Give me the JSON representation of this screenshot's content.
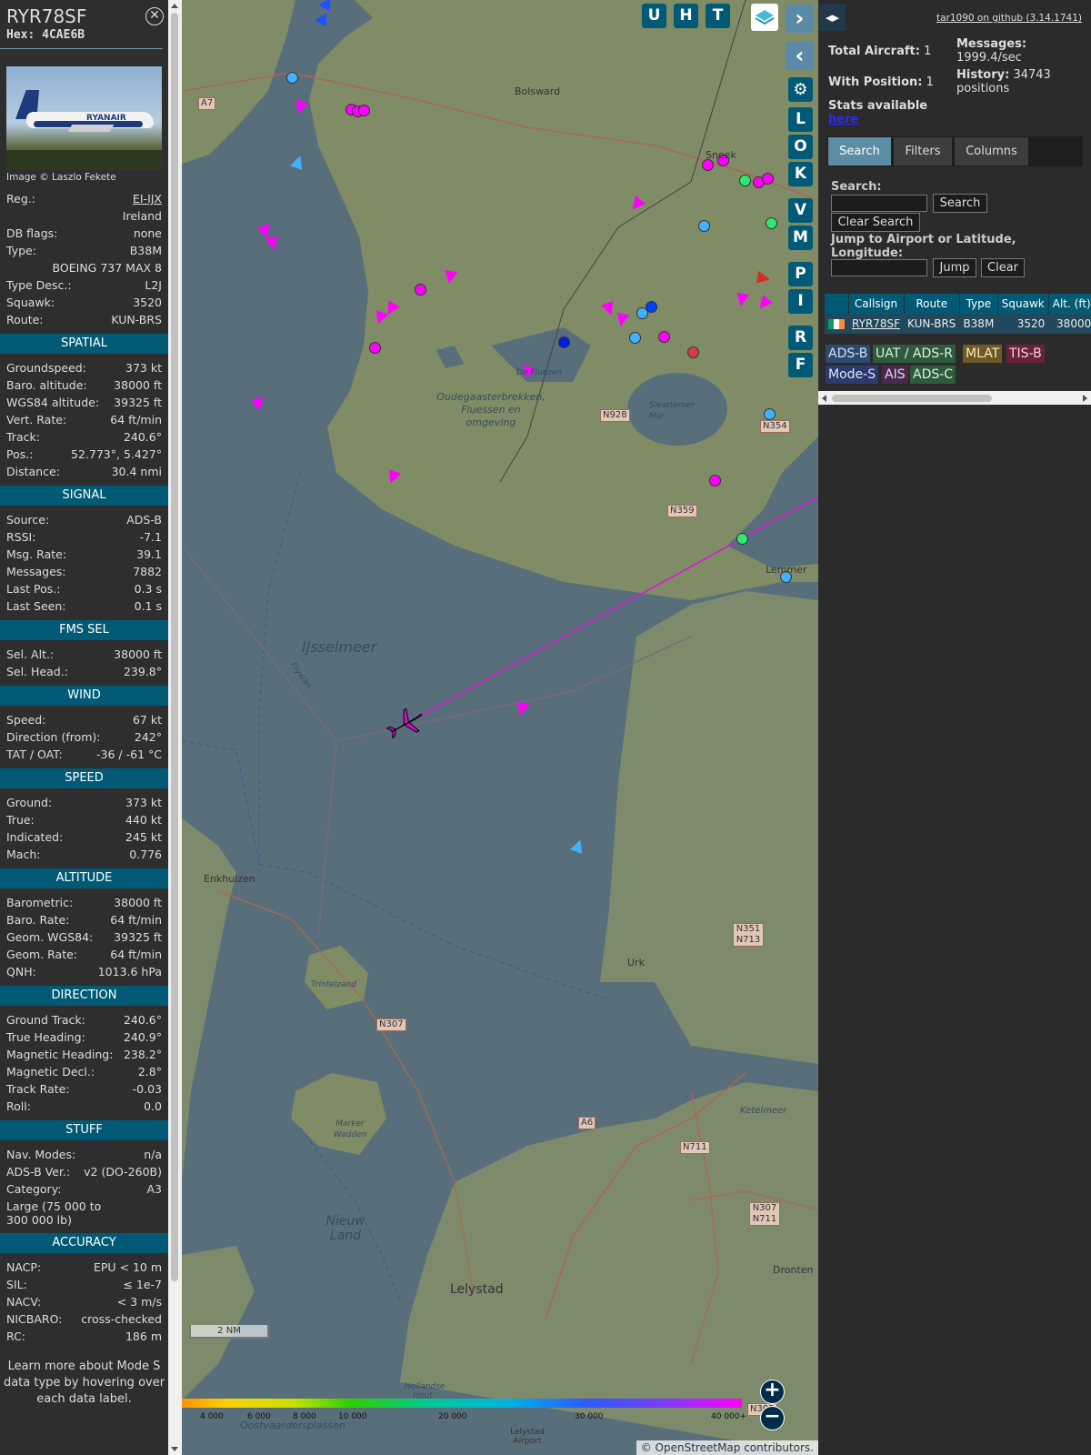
{
  "infoblock": {
    "callsign": "RYR78SF",
    "hex": "Hex: 4CAE6B",
    "photo_brand": "RYANAIR",
    "photo_credit": "Image © Laszlo Fekete",
    "details": [
      {
        "k": "Reg.:",
        "v": "EI-IJX"
      },
      {
        "k": "",
        "v": "Ireland"
      },
      {
        "k": "DB flags:",
        "v": "none"
      },
      {
        "k": "Type:",
        "v": "B38M"
      },
      {
        "k": "",
        "v": "BOEING 737 MAX 8"
      },
      {
        "k": "Type Desc.:",
        "v": "L2J"
      },
      {
        "k": "Squawk:",
        "v": "3520"
      },
      {
        "k": "Route:",
        "v": "KUN-BRS"
      }
    ],
    "sections": [
      {
        "title": "SPATIAL",
        "rows": [
          {
            "k": "Groundspeed:",
            "v": "373 kt"
          },
          {
            "k": "Baro. altitude:",
            "v": "38000 ft"
          },
          {
            "k": "WGS84 altitude:",
            "v": "39325 ft"
          },
          {
            "k": "Vert. Rate:",
            "v": "64 ft/min"
          },
          {
            "k": "Track:",
            "v": "240.6°"
          },
          {
            "k": "Pos.:",
            "v": "52.773°, 5.427°"
          },
          {
            "k": "Distance:",
            "v": "30.4 nmi"
          }
        ]
      },
      {
        "title": "SIGNAL",
        "rows": [
          {
            "k": "Source:",
            "v": "ADS-B"
          },
          {
            "k": "RSSI:",
            "v": "-7.1"
          },
          {
            "k": "Msg. Rate:",
            "v": "39.1"
          },
          {
            "k": "Messages:",
            "v": "7882"
          },
          {
            "k": "Last Pos.:",
            "v": "0.3 s"
          },
          {
            "k": "Last Seen:",
            "v": "0.1 s"
          }
        ]
      },
      {
        "title": "FMS SEL",
        "rows": [
          {
            "k": "Sel. Alt.:",
            "v": "38000 ft"
          },
          {
            "k": "Sel. Head.:",
            "v": "239.8°"
          }
        ]
      },
      {
        "title": "WIND",
        "rows": [
          {
            "k": "Speed:",
            "v": "67 kt"
          },
          {
            "k": "Direction (from):",
            "v": "242°"
          },
          {
            "k": "TAT / OAT:",
            "v": "-36 / -61 °C"
          }
        ]
      },
      {
        "title": "SPEED",
        "rows": [
          {
            "k": "Ground:",
            "v": "373 kt"
          },
          {
            "k": "True:",
            "v": "440 kt"
          },
          {
            "k": "Indicated:",
            "v": "245 kt"
          },
          {
            "k": "Mach:",
            "v": "0.776"
          }
        ]
      },
      {
        "title": "ALTITUDE",
        "rows": [
          {
            "k": "Barometric:",
            "v": "38000 ft"
          },
          {
            "k": "Baro. Rate:",
            "v": "64 ft/min"
          },
          {
            "k": "Geom. WGS84:",
            "v": "39325 ft"
          },
          {
            "k": "Geom. Rate:",
            "v": "64 ft/min"
          },
          {
            "k": "QNH:",
            "v": "1013.6 hPa"
          }
        ]
      },
      {
        "title": "DIRECTION",
        "rows": [
          {
            "k": "Ground Track:",
            "v": "240.6°"
          },
          {
            "k": "True Heading:",
            "v": "240.9°"
          },
          {
            "k": "Magnetic Heading:",
            "v": "238.2°"
          },
          {
            "k": "Magnetic Decl.:",
            "v": "2.8°"
          },
          {
            "k": "Track Rate:",
            "v": "-0.03"
          },
          {
            "k": "Roll:",
            "v": "0.0"
          }
        ]
      },
      {
        "title": "STUFF",
        "rows": [
          {
            "k": "Nav. Modes:",
            "v": "n/a"
          },
          {
            "k": "ADS-B Ver.:",
            "v": "v2 (DO-260B)"
          },
          {
            "k": "Category:",
            "v": "A3"
          },
          {
            "k": "Large (75 000 to 300 000 lb)",
            "v": "",
            "wrap": true
          }
        ]
      },
      {
        "title": "ACCURACY",
        "rows": [
          {
            "k": "NACP:",
            "v": "EPU < 10 m"
          },
          {
            "k": "SIL:",
            "v": "≤ 1e-7"
          },
          {
            "k": "NACV:",
            "v": "< 3 m/s"
          },
          {
            "k": "NICBARO:",
            "v": "cross-checked"
          },
          {
            "k": "RC:",
            "v": "186 m"
          }
        ]
      }
    ],
    "learn_more": "Learn more about Mode S data type by hovering over each data label."
  },
  "map": {
    "buttons_top": [
      "U",
      "H",
      "T"
    ],
    "buttons_side": [
      "L",
      "O",
      "K",
      "V",
      "M",
      "P",
      "I",
      "R",
      "F"
    ],
    "labels": [
      {
        "id": "bolsward",
        "text": "Bolsward"
      },
      {
        "id": "sneek",
        "text": "Sneek"
      },
      {
        "id": "ijsselmeer",
        "text": "IJsselmeer"
      },
      {
        "id": "oudega",
        "text": "Oudegaasterbrekken, Fluessen en omgeving"
      },
      {
        "id": "sleattemer",
        "text": "Sleattemer Mar"
      },
      {
        "id": "lemmer",
        "text": "Lemmer"
      },
      {
        "id": "enkhuizen",
        "text": "Enkhuizen"
      },
      {
        "id": "urk",
        "text": "Urk"
      },
      {
        "id": "lelystad",
        "text": "Lelystad"
      },
      {
        "id": "dronten",
        "text": "Dronten"
      },
      {
        "id": "nieuw-land",
        "text": "Nieuw Land"
      },
      {
        "id": "marker-wadden",
        "text": "Marker Wadden"
      },
      {
        "id": "trintelzand",
        "text": "Trintelzand"
      },
      {
        "id": "ketelmeer",
        "text": "Ketelmeer"
      },
      {
        "id": "oostvaardersplassen",
        "text": "Oostvaardersplassen"
      },
      {
        "id": "lelystad-airport",
        "text": "Lelystad Airport"
      },
      {
        "id": "hollandse-hout",
        "text": "Hollandse Hout"
      },
      {
        "id": "fryslan",
        "text": "Fryslân"
      },
      {
        "id": "de-fluezen",
        "text": "De Fluezen"
      }
    ],
    "roads": [
      "A7",
      "N928",
      "N354",
      "N359",
      "N307",
      "A6",
      "N711",
      "N351 N713",
      "N307 N711",
      "N302"
    ],
    "scale_label": "2 NM",
    "altitude_scale": [
      "4 000",
      "6 000",
      "8 000",
      "10 000",
      "20 000",
      "30 000",
      "40 000+"
    ],
    "attribution": "© OpenStreetMap contributors."
  },
  "sidebar": {
    "github_link": "tar1090 on github (3.14.1741)",
    "total_aircraft_label": "Total Aircraft:",
    "total_aircraft": "1",
    "with_position_label": "With Position:",
    "with_position": "1",
    "stats_label": "Stats available",
    "stats_link": "here",
    "messages_label": "Messages:",
    "messages_rate": "1999.4/sec",
    "history_label": "History:",
    "history_count": "34743",
    "history_unit": "positions",
    "tabs": [
      "Search",
      "Filters",
      "Columns"
    ],
    "search_label": "Search:",
    "search_button": "Search",
    "clear_search_button": "Clear Search",
    "jump_label": "Jump to Airport or Latitude, Longitude:",
    "jump_button": "Jump",
    "clear_button": "Clear",
    "table_headers": [
      "",
      "Callsign",
      "Route",
      "Type",
      "Squawk",
      "Alt. (ft)"
    ],
    "table_rows": [
      {
        "callsign": "RYR78SF",
        "route": "KUN-BRS",
        "type": "B38M",
        "squawk": "3520",
        "alt": "38000"
      }
    ],
    "sources": [
      {
        "label": "ADS-B",
        "color": "#2c4a6e",
        "text": "#cfe0ff"
      },
      {
        "label": "UAT / ADS-R",
        "color": "#2f5a3d",
        "text": "#d8f5d8"
      },
      {
        "label": "MLAT",
        "color": "#6b5a28",
        "text": "#ffe9b0"
      },
      {
        "label": "TIS-B",
        "color": "#6a2238",
        "text": "#ffd0dc"
      },
      {
        "label": "Mode-S",
        "color": "#2c3a6e",
        "text": "#dfe4ff"
      },
      {
        "label": "AIS",
        "color": "#4a2a4a",
        "text": "#f5d0f5"
      },
      {
        "label": "ADS-C",
        "color": "#2f5a3d",
        "text": "#d8f5d8"
      }
    ]
  }
}
